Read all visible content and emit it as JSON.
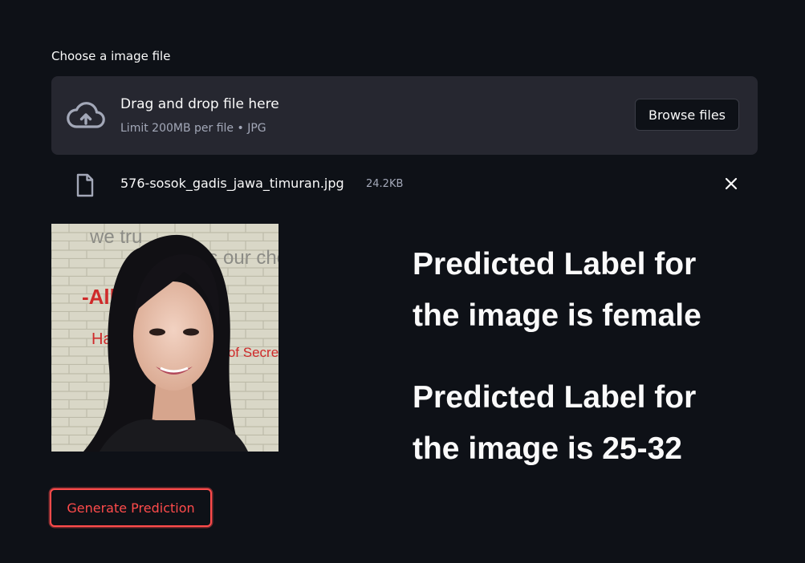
{
  "uploader": {
    "label": "Choose a image file",
    "title": "Drag and drop file here",
    "subtitle": "Limit 200MB per file • JPG",
    "browse_label": "Browse files",
    "icon": "cloud-upload-icon"
  },
  "uploaded_file": {
    "name": "576-sosok_gadis_jawa_timuran.jpg",
    "size": "24.2KB",
    "icon": "file-icon",
    "remove_icon": "close-icon"
  },
  "image": {
    "wall_text": [
      "we tru",
      "is our choic",
      "-Alb",
      "Har",
      "er of Secret"
    ]
  },
  "results": {
    "gender": "Predicted Label for the image is female",
    "age": "Predicted Label for the image is 25-32"
  },
  "actions": {
    "generate_label": "Generate Prediction"
  },
  "colors": {
    "background": "#0e1117",
    "panel": "#262730",
    "accent": "#ff4b4b",
    "muted_text": "#a3a8b8"
  }
}
